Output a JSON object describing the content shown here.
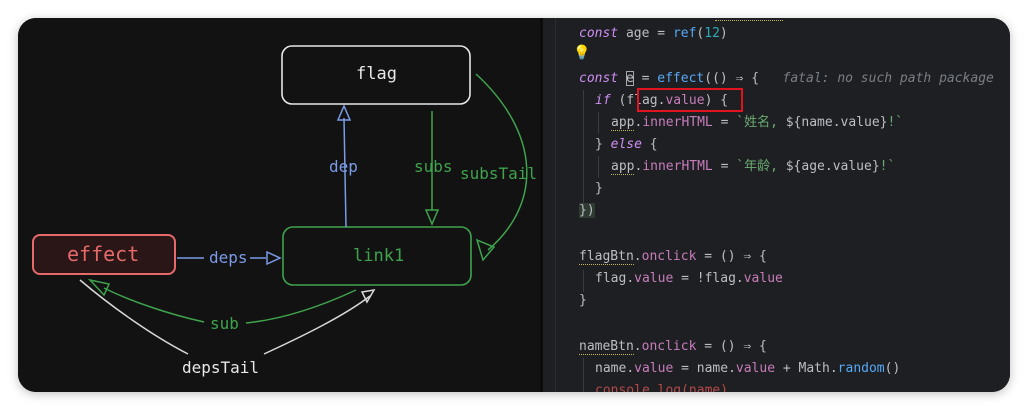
{
  "diagram": {
    "nodes": {
      "flag": "flag",
      "effect": "effect",
      "link1": "link1"
    },
    "edges": {
      "dep": "dep",
      "subs": "subs",
      "subsTail": "subsTail",
      "deps": "deps",
      "sub": "sub",
      "depsTail": "depsTail"
    }
  },
  "code": {
    "l1": {
      "kw": "const",
      "rest": " age = ",
      "fn": "ref",
      "open": "(",
      "num": "12",
      "close": ")"
    },
    "l3": {
      "kw": "const",
      "cursor": "e",
      "mid": " = ",
      "fn": "effect",
      "rest": "(() ⇒ {",
      "hint": "fatal: no such path package"
    },
    "l4": {
      "kw": "if",
      "open": " (",
      "obj": "flag",
      "dot": ".",
      "field": "value",
      "close": ") {"
    },
    "l5": {
      "obj": "app",
      "dot": ".",
      "field": "innerHTML",
      "eq": " = ",
      "str1": "`姓名, ",
      "interp": "${name.value}",
      "str2": "!`"
    },
    "l6": {
      "open": "} ",
      "kw": "else",
      "rest": " {"
    },
    "l7": {
      "obj": "app",
      "dot": ".",
      "field": "innerHTML",
      "eq": " = ",
      "str1": "`年龄, ",
      "interp": "${age.value}",
      "str2": "!`"
    },
    "l8": "}",
    "l9": "})",
    "l11": {
      "obj": "flagBtn",
      "dot": ".",
      "field": "onclick",
      "rest": " = () ⇒ {"
    },
    "l12": {
      "obj": "flag",
      "dot": ".",
      "field": "value",
      "eq": " = !",
      "obj2": "flag",
      "dot2": ".",
      "field2": "value"
    },
    "l13": "}",
    "l15": {
      "obj": "nameBtn",
      "dot": ".",
      "field": "onclick",
      "rest": " = () ⇒ {"
    },
    "l16": {
      "obj": "name",
      "dot": ".",
      "field": "value",
      "eq": " = ",
      "obj2": "name",
      "dot2": ".",
      "field2": "value",
      "plus": " + ",
      "obj3": "Math",
      "dot3": ".",
      "fn": "random",
      "call": "()"
    },
    "l17": {
      "obj": "console",
      "dot": ".",
      "fn": "log",
      "rest": "(name)"
    }
  },
  "colors": {
    "effect": "#e66a6a",
    "link": "#3fa34d",
    "dep": "#7b9be6",
    "white": "#e8e8e8",
    "highlight": "#e0131f"
  },
  "icons": {
    "bulb": "lightbulb-icon"
  }
}
